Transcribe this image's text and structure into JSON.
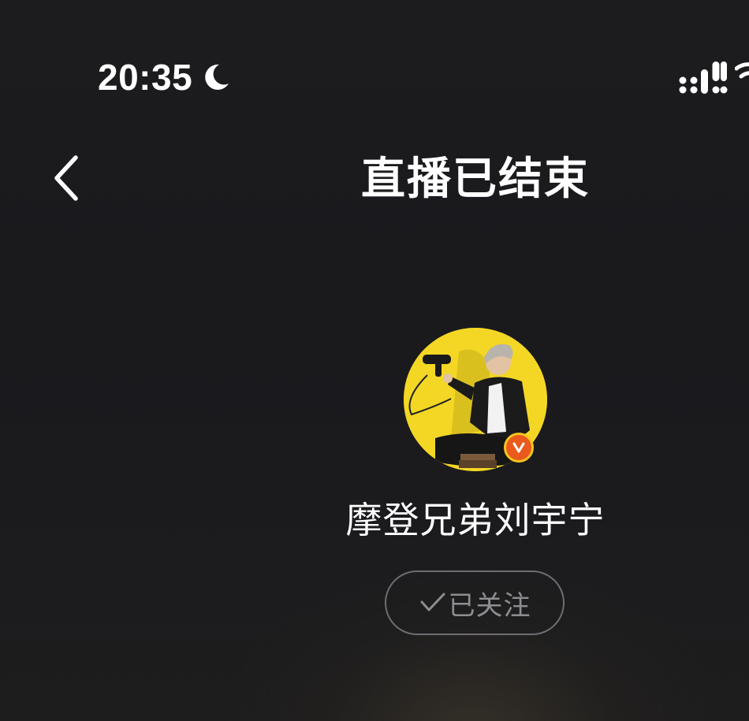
{
  "status_bar": {
    "time": "20:35",
    "icons": [
      "moon-icon",
      "signal-icon",
      "wifi-icon"
    ]
  },
  "nav": {
    "back_icon": "chevron-left-icon",
    "title": "直播已结束"
  },
  "profile": {
    "name": "摩登兄弟刘宇宁",
    "verified": true,
    "badge_icon": "v-verified-icon",
    "follow_label": "已关注",
    "follow_icon": "check-icon"
  },
  "colors": {
    "background": "#1b1b1e",
    "avatar_bg": "#f3d724",
    "badge": "#e95a1c",
    "follow_text": "#8d8d92",
    "follow_border": "#6e6e72"
  }
}
